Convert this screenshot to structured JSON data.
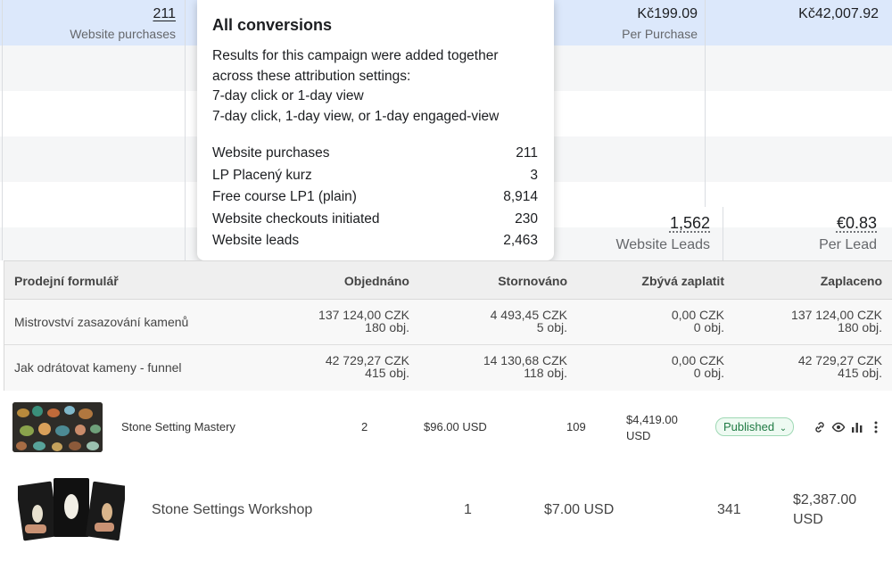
{
  "ads": {
    "top_row": {
      "purchases_value": "211",
      "purchases_label": "Website purchases",
      "cost_per_value": "Kč199.09",
      "cost_per_label": "Per Purchase",
      "amount_value": "Kč42,007.92"
    },
    "leads_row": {
      "leads_value": "1,562",
      "leads_label": "Website Leads",
      "per_lead_value": "€0.83",
      "per_lead_label": "Per Lead"
    }
  },
  "tooltip": {
    "title": "All conversions",
    "desc_1": "Results for this campaign were added together",
    "desc_2": "across these attribution settings:",
    "desc_3": "7-day click or 1-day view",
    "desc_4": "7-day click, 1-day view, or 1-day engaged-view",
    "rows": [
      {
        "label": "Website purchases",
        "value": "211"
      },
      {
        "label": "LP Placený kurz",
        "value": "3"
      },
      {
        "label": "Free course LP1 (plain)",
        "value": "8,914"
      },
      {
        "label": "Website checkouts initiated",
        "value": "230"
      },
      {
        "label": "Website leads",
        "value": "2,463"
      }
    ]
  },
  "orders": {
    "headers": [
      "Prodejní formulář",
      "Objednáno",
      "Stornováno",
      "Zbývá zaplatit",
      "Zaplaceno"
    ],
    "rows": [
      {
        "name": "Mistrovství zasazování kamenů",
        "ordered_amount": "137 124,00 CZK",
        "ordered_count": "180 obj.",
        "cancelled_amount": "4 493,45 CZK",
        "cancelled_count": "5 obj.",
        "remaining_amount": "0,00 CZK",
        "remaining_count": "0 obj.",
        "paid_amount": "137 124,00 CZK",
        "paid_count": "180 obj."
      },
      {
        "name": "Jak odrátovat kameny - funnel",
        "ordered_amount": "42 729,27 CZK",
        "ordered_count": "415 obj.",
        "cancelled_amount": "14 130,68 CZK",
        "cancelled_count": "118 obj.",
        "remaining_amount": "0,00 CZK",
        "remaining_count": "0 obj.",
        "paid_amount": "42 729,27 CZK",
        "paid_count": "415 obj."
      }
    ]
  },
  "products": [
    {
      "name": "Stone Setting Mastery",
      "qty": "2",
      "price": "$96.00 USD",
      "sales": "109",
      "revenue_line1": "$4,419.00",
      "revenue_line2": "USD",
      "status": "Published",
      "icons": [
        "link-icon",
        "eye-icon",
        "bar-chart-icon",
        "more-icon"
      ]
    },
    {
      "name": "Stone Settings Workshop",
      "qty": "1",
      "price": "$7.00 USD",
      "sales": "341",
      "revenue_line1": "$2,387.00",
      "revenue_line2": "USD"
    }
  ],
  "colors": {
    "highlight_row": "#dce8fb",
    "published_green": "#1f7a43",
    "table_header": "#efefef"
  }
}
